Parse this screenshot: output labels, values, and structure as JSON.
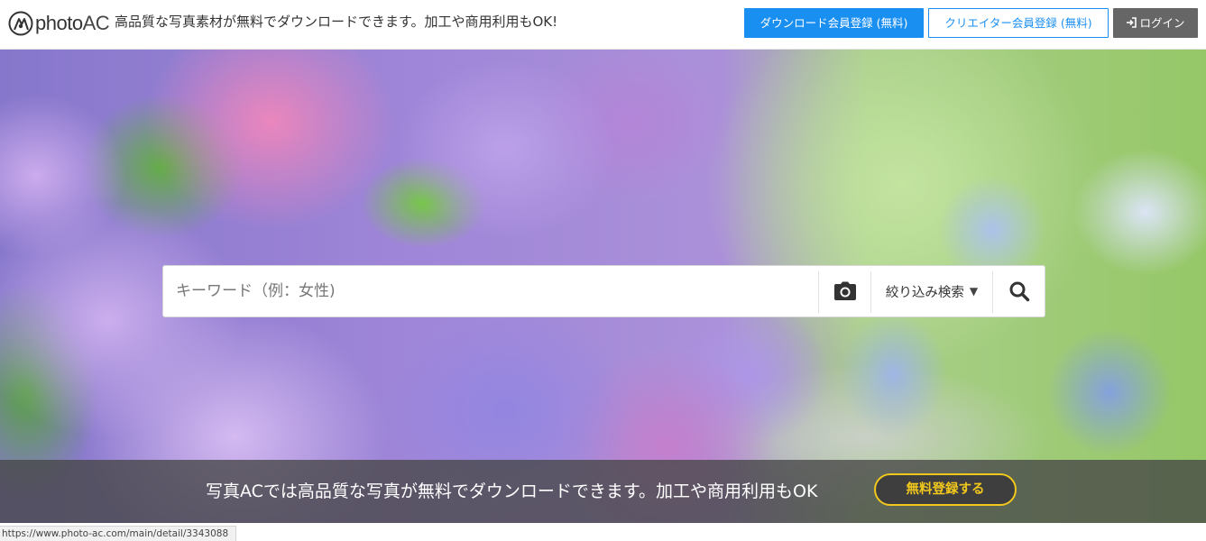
{
  "header": {
    "logo": {
      "text_main": "photo",
      "text_accent": "AC",
      "icon": "photoac-logo-icon"
    },
    "tagline": "高品質な写真素材が無料でダウンロードできます。加工や商用利用もOK!",
    "download_register_label": "ダウンロード会員登録 (無料)",
    "creator_register_label": "クリエイター会員登録 (無料)",
    "login_label": "ログイン",
    "login_icon": "sign-in-icon"
  },
  "search": {
    "placeholder": "キーワード（例：女性)",
    "camera_icon": "camera-icon",
    "filter_label": "絞り込み検索",
    "filter_arrow": "▼",
    "search_icon": "search-icon"
  },
  "banner": {
    "text": "写真ACでは高品質な写真が無料でダウンロードできます。加工や商用利用もOK",
    "cta_label": "無料登録する"
  },
  "statusbar": {
    "url": "https://www.photo-ac.com/main/detail/3343088"
  },
  "colors": {
    "primary_blue": "#1a8ff2",
    "login_gray": "#666666",
    "cta_yellow": "#f2c81c",
    "banner_overlay": "#464646"
  }
}
